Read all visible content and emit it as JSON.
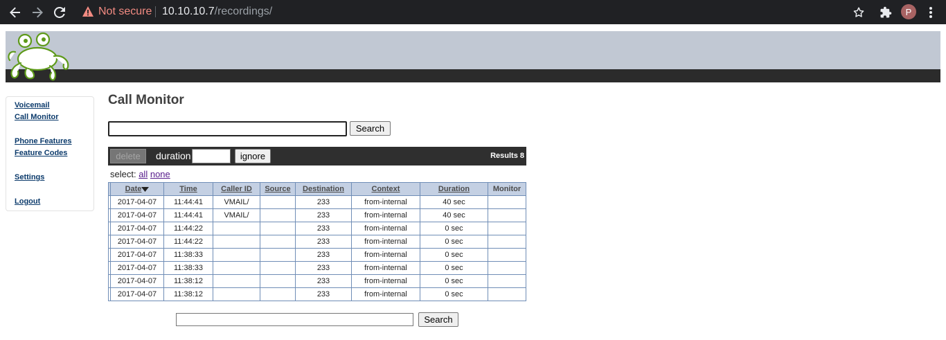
{
  "browser": {
    "security_label": "Not secure",
    "url_host": "10.10.10.7",
    "url_path": "/recordings/",
    "profile_initial": "P"
  },
  "sidebar": {
    "items": [
      {
        "label": "Voicemail"
      },
      {
        "label": "Call Monitor"
      },
      {
        "label": "Phone Features"
      },
      {
        "label": "Feature Codes"
      },
      {
        "label": "Settings"
      },
      {
        "label": "Logout"
      }
    ]
  },
  "main": {
    "title": "Call Monitor",
    "search_button": "Search",
    "search_value": "",
    "toolbar": {
      "delete_label": "delete",
      "duration_label": "duration",
      "duration_value": "",
      "ignore_label": "ignore",
      "results_label": "Results 8"
    },
    "select": {
      "label": "select:",
      "all": "all",
      "none": "none"
    },
    "table": {
      "columns": [
        "Date",
        "Time",
        "Caller ID",
        "Source",
        "Destination",
        "Context",
        "Duration",
        "Monitor"
      ],
      "sort_column": "Date",
      "sort_direction": "descending",
      "rows": [
        [
          "2017-04-07",
          "11:44:41",
          "VMAIL/",
          "",
          "233",
          "from-internal",
          "40 sec",
          ""
        ],
        [
          "2017-04-07",
          "11:44:41",
          "VMAIL/",
          "",
          "233",
          "from-internal",
          "40 sec",
          ""
        ],
        [
          "2017-04-07",
          "11:44:22",
          "",
          "",
          "233",
          "from-internal",
          "0 sec",
          ""
        ],
        [
          "2017-04-07",
          "11:44:22",
          "",
          "",
          "233",
          "from-internal",
          "0 sec",
          ""
        ],
        [
          "2017-04-07",
          "11:38:33",
          "",
          "",
          "233",
          "from-internal",
          "0 sec",
          ""
        ],
        [
          "2017-04-07",
          "11:38:33",
          "",
          "",
          "233",
          "from-internal",
          "0 sec",
          ""
        ],
        [
          "2017-04-07",
          "11:38:12",
          "",
          "",
          "233",
          "from-internal",
          "0 sec",
          ""
        ],
        [
          "2017-04-07",
          "11:38:12",
          "",
          "",
          "233",
          "from-internal",
          "0 sec",
          ""
        ]
      ]
    },
    "bottom_search_button": "Search"
  },
  "colors": {
    "banner": "#c1c8d3",
    "banner_bar": "#2b2b2b",
    "table_header": "#c4d0e3",
    "table_border": "#6f8db6",
    "toolbar": "#2f2f2f",
    "link": "#0b3a6b",
    "not_secure": "#f28b82"
  },
  "icons": [
    "back-arrow-icon",
    "forward-arrow-icon",
    "reload-icon",
    "warning-icon",
    "star-icon",
    "extensions-icon",
    "kebab-menu-icon",
    "frog-logo",
    "sort-desc-icon"
  ]
}
